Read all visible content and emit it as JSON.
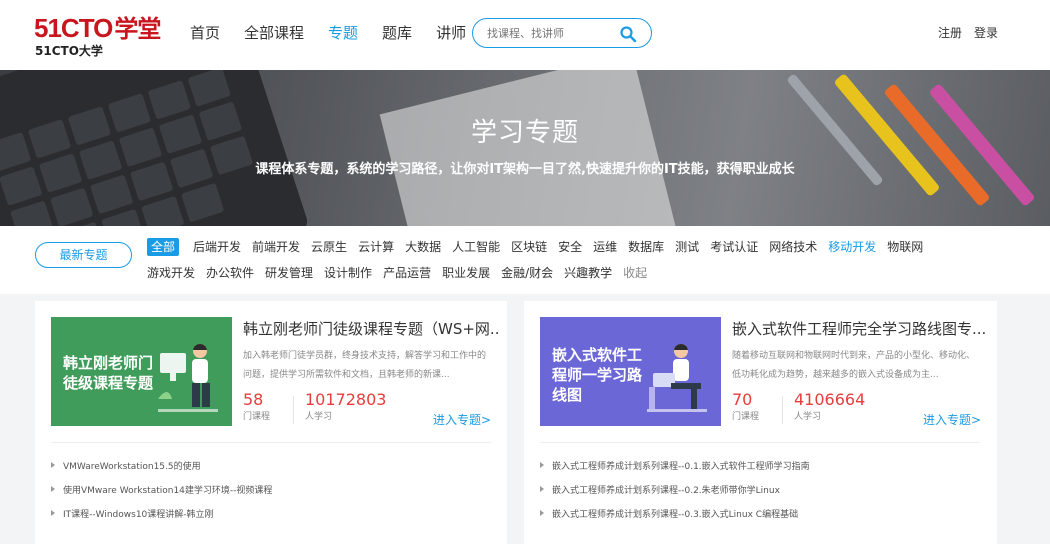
{
  "header": {
    "logo_main": "51CTO",
    "logo_main_cn": "学堂",
    "logo_sub": "51CTO大学",
    "nav": [
      {
        "label": "首页",
        "active": false
      },
      {
        "label": "全部课程",
        "active": false
      },
      {
        "label": "专题",
        "active": true
      },
      {
        "label": "题库",
        "active": false
      },
      {
        "label": "讲师",
        "active": false
      }
    ],
    "search_placeholder": "找课程、找讲师",
    "register": "注册",
    "login": "登录"
  },
  "banner": {
    "title": "学习专题",
    "subtitle": "课程体系专题，系统的学习路径，让你对IT架构一目了然,快速提升你的IT技能，获得职业成长"
  },
  "categories": {
    "latest": "最新专题",
    "row1": [
      "全部",
      "后端开发",
      "前端开发",
      "云原生",
      "云计算",
      "大数据",
      "人工智能",
      "区块链",
      "安全",
      "运维",
      "数据库",
      "测试",
      "考试认证",
      "网络技术",
      "移动开发",
      "物联网"
    ],
    "row2": [
      "游戏开发",
      "办公软件",
      "研发管理",
      "设计制作",
      "产品运营",
      "职业发展",
      "金融/财会",
      "兴趣教学",
      "收起"
    ]
  },
  "cards": [
    {
      "thumb_text": "韩立刚老师门徒级课程专题",
      "thumb_color": "#3f9c5a",
      "title": "韩立刚老师门徒级课程专题（WS+网...",
      "desc": "加入韩老师门徒学员群，终身技术支持，解答学习和工作中的问题，提供学习所需软件和文档，且韩老师的新课...",
      "courses": "58",
      "courses_label": "门课程",
      "learners": "10172803",
      "learners_label": "人学习",
      "enter": "进入专题>",
      "items": [
        "VMWareWorkstation15.5的使用",
        "使用VMware Workstation14建学习环境--视频课程",
        "IT课程--Windows10课程讲解-韩立刚"
      ]
    },
    {
      "thumb_text": "嵌入式软件工程师一学习路线图",
      "thumb_color": "#6b67d6",
      "title": "嵌入式软件工程师完全学习路线图专...",
      "desc": "随着移动互联网和物联网时代到来，产品的小型化、移动化、低功耗化成为趋势，越来越多的嵌入式设备成为主...",
      "courses": "70",
      "courses_label": "门课程",
      "learners": "4106664",
      "learners_label": "人学习",
      "enter": "进入专题>",
      "items": [
        "嵌入式工程师养成计划系列课程--0.1.嵌入式软件工程师学习指南",
        "嵌入式工程师养成计划系列课程--0.2.朱老师带你学Linux",
        "嵌入式工程师养成计划系列课程--0.3.嵌入式Linux C编程基础"
      ]
    }
  ],
  "colors": {
    "brand_red": "#c8161e",
    "accent_blue": "#1a9be6",
    "number_red": "#e73c3c"
  }
}
